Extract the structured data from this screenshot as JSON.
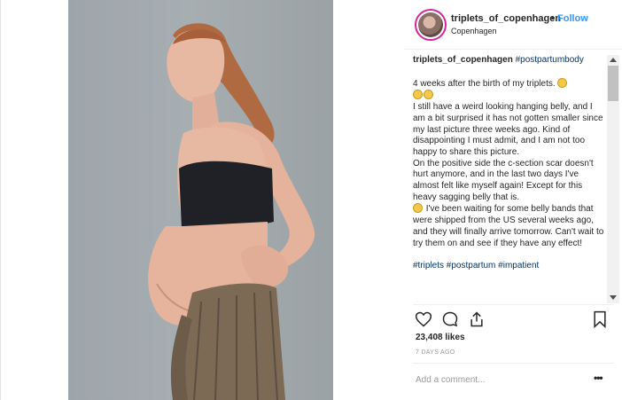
{
  "post": {
    "username": "triplets_of_copenhagen",
    "separator": "•",
    "follow_label": "Follow",
    "location": "Copenhagen"
  },
  "caption": {
    "username": "triplets_of_copenhagen",
    "hashtag_head": "#postpartumbody",
    "lines": [
      "4 weeks after the birth of my triplets.",
      "I still have a weird looking hanging belly, and I am a bit surprised it has not gotten smaller since my last picture three weeks ago. Kind of disappointing I must admit, and I am not too happy to share this picture.",
      "On the positive side the c-section scar doesn't hurt anymore, and in the last two days I've almost felt like myself again! Except for this heavy sagging belly that is.",
      "I've been waiting for some belly bands that were shipped from the US several weeks ago, and they will finally arrive tomorrow. Can't wait to try them on and see if they have any effect!"
    ],
    "hashtags": "#triplets #postpartum #impatient"
  },
  "stats": {
    "likes": "23,408 likes",
    "time": "7 DAYS AGO"
  },
  "comment_box": {
    "placeholder": "Add a comment..."
  },
  "icons": {
    "like": "heart-icon",
    "comment": "comment-bubble-icon",
    "share": "share-icon",
    "save": "bookmark-icon",
    "more": "more-options-icon"
  },
  "colors": {
    "link": "#3897f0",
    "hashtag": "#003569",
    "text": "#262626",
    "muted": "#999999"
  }
}
